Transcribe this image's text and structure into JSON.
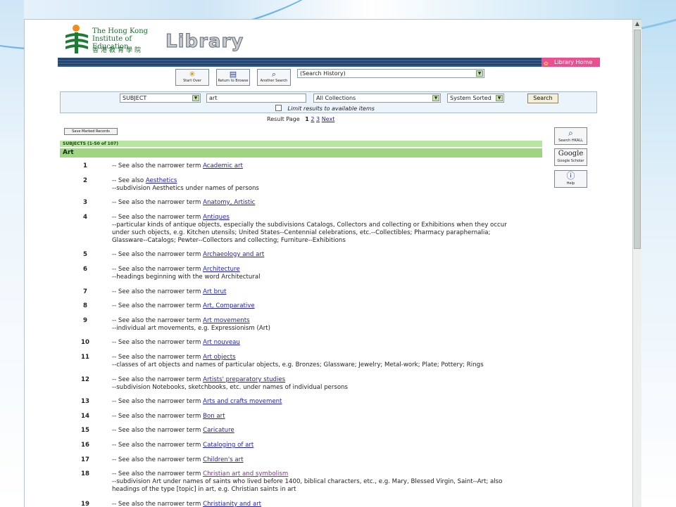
{
  "header": {
    "logo_en": "The Hong Kong Institute of Education",
    "logo_zh": "香港教育學院",
    "library_title": "Library",
    "library_home": "Library Home"
  },
  "toolbar": {
    "start_over": "Start Over",
    "return_to_browse": "Return to Browse",
    "another_search": "Another Search",
    "search_history": "(Search History)"
  },
  "search": {
    "type": "SUBJECT",
    "query": "art",
    "collection": "All Collections",
    "sort": "System Sorted",
    "button": "Search",
    "limit_label": "Limit results to available items"
  },
  "pagination": {
    "label": "Result Page",
    "current": "1",
    "page2": "2",
    "page3": "3",
    "next": "Next"
  },
  "save_marked": "Save Marked Records",
  "subjects_header": "SUBJECTS (1-50 of 107)",
  "heading": "Art",
  "side": {
    "search_hkall": "Search HKALL",
    "google_logo": "Google",
    "google_scholar": "Google Scholar",
    "help": "Help"
  },
  "results": [
    {
      "num": "1",
      "prefix": "-- See also the narrower term ",
      "term": "Academic art",
      "notes": []
    },
    {
      "num": "2",
      "prefix": "-- See also ",
      "term": "Aesthetics",
      "notes": [
        "--subdivision Aesthetics under names of persons"
      ]
    },
    {
      "num": "3",
      "prefix": "-- See also the narrower term ",
      "term": "Anatomy, Artistic",
      "notes": []
    },
    {
      "num": "4",
      "prefix": "-- See also the narrower term ",
      "term": "Antiques",
      "notes": [
        "--particular kinds of antique objects, especially the subdivisions Catalogs, Collectors and collecting or Exhibitions when they occur",
        "under such objects, e.g. Kitchen utensils; United States--Centennial celebrations, etc.--Collectibles; Pharmacy paraphernalia;",
        "Glassware--Catalogs; Pewter--Collectors and collecting; Furniture--Exhibitions"
      ]
    },
    {
      "num": "5",
      "prefix": "-- See also the narrower term ",
      "term": "Archaeology and art",
      "notes": []
    },
    {
      "num": "6",
      "prefix": "-- See also the narrower term ",
      "term": "Architecture",
      "notes": [
        "--headings beginning with the word Architectural"
      ]
    },
    {
      "num": "7",
      "prefix": "-- See also the narrower term ",
      "term": "Art brut",
      "notes": []
    },
    {
      "num": "8",
      "prefix": "-- See also the narrower term ",
      "term": "Art, Comparative",
      "notes": []
    },
    {
      "num": "9",
      "prefix": "-- See also the narrower term ",
      "term": "Art movements",
      "notes": [
        "--individual art movements, e.g. Expressionism (Art)"
      ]
    },
    {
      "num": "10",
      "prefix": "-- See also the narrower term ",
      "term": "Art nouveau",
      "notes": []
    },
    {
      "num": "11",
      "prefix": "-- See also the narrower term ",
      "term": "Art objects",
      "notes": [
        "--classes of art objects and names of particular objects, e.g. Bronzes; Glassware; Jewelry; Metal-work; Plate; Pottery; Rings"
      ]
    },
    {
      "num": "12",
      "prefix": "-- See also the narrower term ",
      "term": "Artists' preparatory studies",
      "notes": [
        "--subdivision Notebooks, sketchbooks, etc. under names of individual persons"
      ]
    },
    {
      "num": "13",
      "prefix": "-- See also the narrower term ",
      "term": "Arts and crafts movement",
      "notes": []
    },
    {
      "num": "14",
      "prefix": "-- See also the narrower term ",
      "term": "Bon art",
      "notes": []
    },
    {
      "num": "15",
      "prefix": "-- See also the narrower term ",
      "term": "Caricature",
      "notes": []
    },
    {
      "num": "16",
      "prefix": "-- See also the narrower term ",
      "term": "Cataloging of art",
      "notes": []
    },
    {
      "num": "17",
      "prefix": "-- See also the narrower term ",
      "term": "Children's art",
      "notes": []
    },
    {
      "num": "18",
      "prefix": "-- See also the narrower term ",
      "term": "Christian art and symbolism",
      "visited": true,
      "notes": [
        "--subdivision Art under names of saints who lived before 1400, biblical characters, etc., e.g. Mary, Blessed Virgin, Saint--Art; also",
        "headings of the type [topic] in art, e.g. Christian saints in art"
      ]
    },
    {
      "num": "19",
      "prefix": "-- See also the narrower term ",
      "term": "Christianity and art",
      "notes": []
    }
  ]
}
